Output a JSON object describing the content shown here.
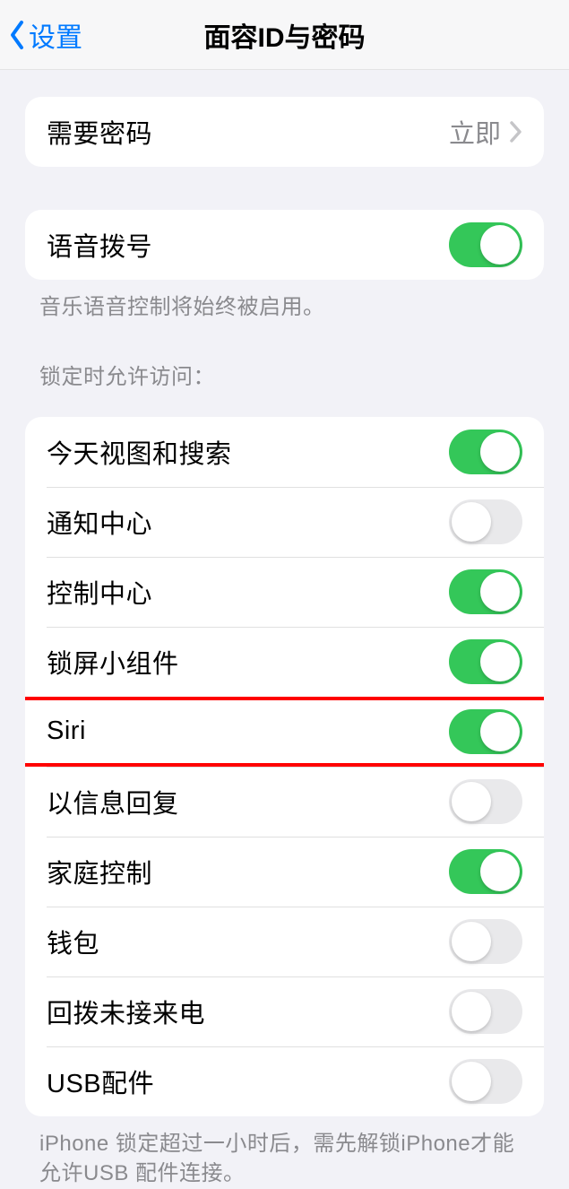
{
  "nav": {
    "back_label": "设置",
    "title": "面容ID与密码"
  },
  "require_passcode": {
    "label": "需要密码",
    "value": "立即"
  },
  "voice_dial": {
    "label": "语音拨号",
    "on": true,
    "footer": "音乐语音控制将始终被启用。"
  },
  "lock_access": {
    "header": "锁定时允许访问：",
    "items": [
      {
        "label": "今天视图和搜索",
        "on": true
      },
      {
        "label": "通知中心",
        "on": false
      },
      {
        "label": "控制中心",
        "on": true
      },
      {
        "label": "锁屏小组件",
        "on": true
      },
      {
        "label": "Siri",
        "on": true
      },
      {
        "label": "以信息回复",
        "on": false
      },
      {
        "label": "家庭控制",
        "on": true
      },
      {
        "label": "钱包",
        "on": false
      },
      {
        "label": "回拨未接来电",
        "on": false
      },
      {
        "label": "USB配件",
        "on": false
      }
    ],
    "footer": "iPhone 锁定超过一小时后，需先解锁iPhone才能允许USB 配件连接。"
  }
}
